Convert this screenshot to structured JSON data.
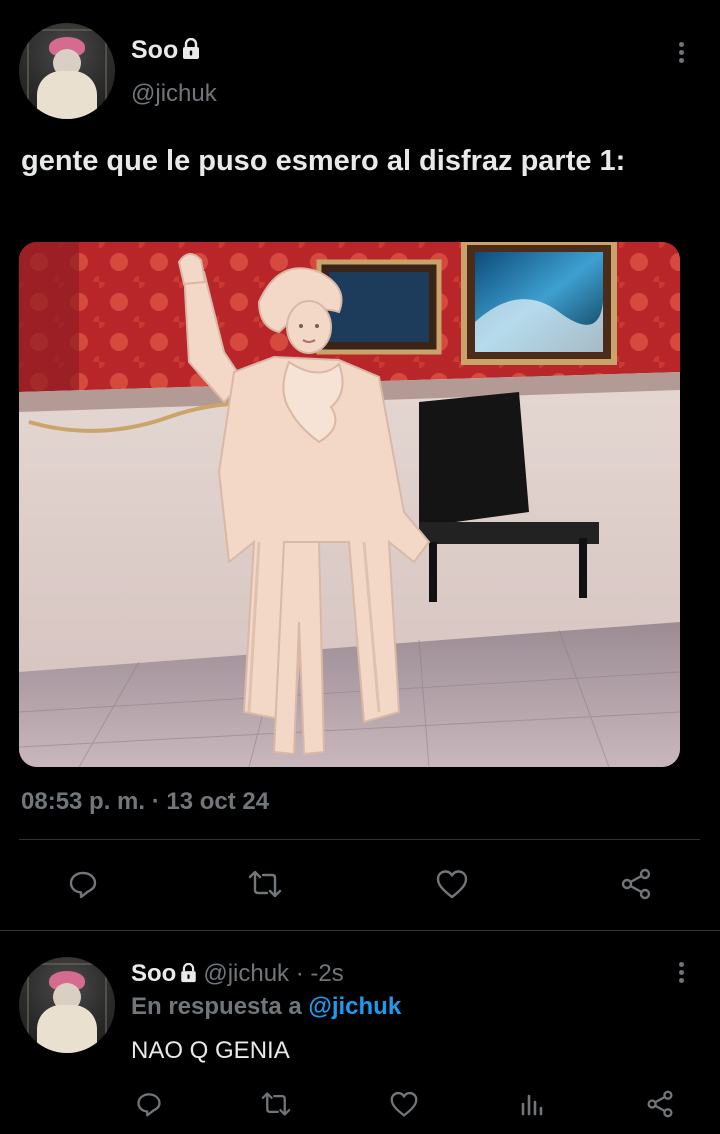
{
  "tweet": {
    "author_name": "Soo",
    "author_handle": "@jichuk",
    "text": "gente que le puso esmero al disfraz parte 1:",
    "timestamp": "08:53 p. m. · 13 oct 24"
  },
  "reply": {
    "author_name": "Soo",
    "author_handle": "@jichuk · -2s",
    "in_reply_prefix": "En respuesta a ",
    "in_reply_mention": "@jichuk",
    "text": "NAO Q GENIA"
  },
  "icons": {
    "verified_lock": "lock-icon",
    "more": "more-vertical-icon",
    "reply": "reply-icon",
    "retweet": "retweet-icon",
    "like": "heart-icon",
    "views": "analytics-icon",
    "share": "share-icon"
  },
  "colors": {
    "background": "#000000",
    "text": "#e7e9ea",
    "muted": "#71767b",
    "accent": "#1d9bf0",
    "divider": "#2f3336"
  }
}
